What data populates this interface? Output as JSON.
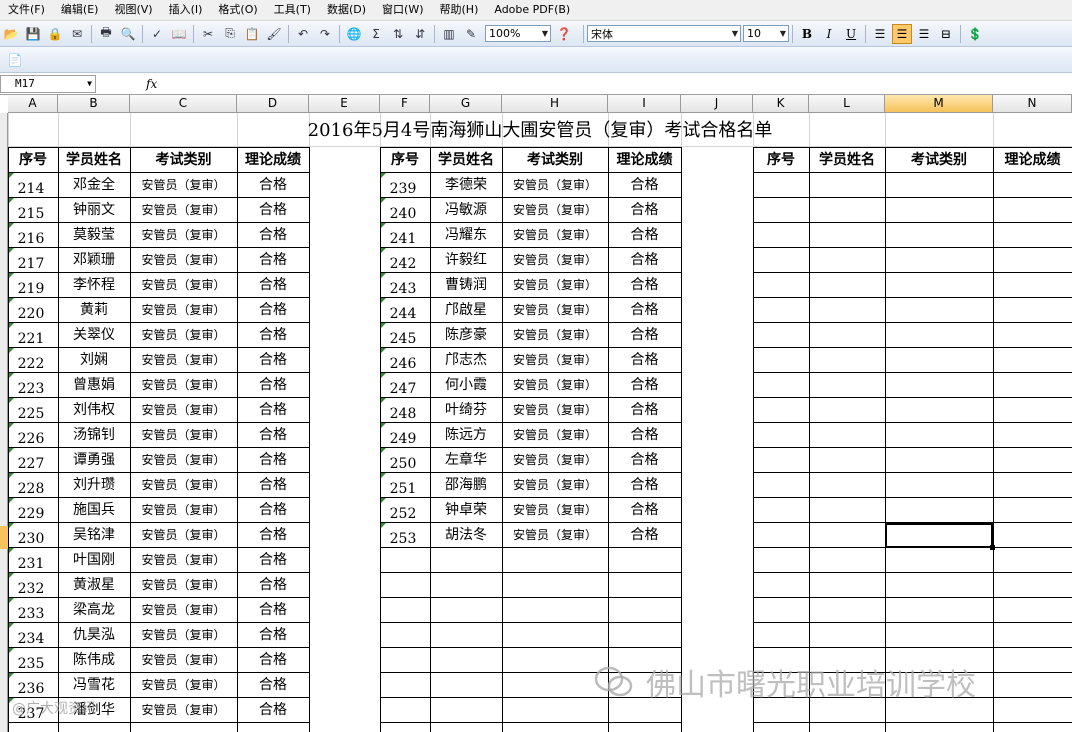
{
  "menu": [
    "文件(F)",
    "编辑(E)",
    "视图(V)",
    "插入(I)",
    "格式(O)",
    "工具(T)",
    "数据(D)",
    "窗口(W)",
    "帮助(H)",
    "Adobe PDF(B)"
  ],
  "toolbar": {
    "zoom": "100%",
    "font_name": "宋体",
    "font_size": "10",
    "bold": "B",
    "italic": "I",
    "underline": "U"
  },
  "formula_bar": {
    "cell_ref": "M17",
    "fx": "fx",
    "content": ""
  },
  "columns": [
    "A",
    "B",
    "C",
    "D",
    "E",
    "F",
    "G",
    "H",
    "I",
    "J",
    "K",
    "L",
    "M",
    "N"
  ],
  "selected_column": "M",
  "sheet": {
    "title": "2016年5月4号南海狮山大圃安管员（复审）考试合格名单",
    "headers": [
      "序号",
      "学员姓名",
      "考试类别",
      "理论成绩"
    ],
    "left": [
      [
        "214",
        "邓金全",
        "安管员（复审）",
        "合格"
      ],
      [
        "215",
        "钟丽文",
        "安管员（复审）",
        "合格"
      ],
      [
        "216",
        "莫毅莹",
        "安管员（复审）",
        "合格"
      ],
      [
        "217",
        "邓颖珊",
        "安管员（复审）",
        "合格"
      ],
      [
        "219",
        "李怀程",
        "安管员（复审）",
        "合格"
      ],
      [
        "220",
        "黄莉",
        "安管员（复审）",
        "合格"
      ],
      [
        "221",
        "关翠仪",
        "安管员（复审）",
        "合格"
      ],
      [
        "222",
        "刘娴",
        "安管员（复审）",
        "合格"
      ],
      [
        "223",
        "曾惠娟",
        "安管员（复审）",
        "合格"
      ],
      [
        "225",
        "刘伟权",
        "安管员（复审）",
        "合格"
      ],
      [
        "226",
        "汤锦钊",
        "安管员（复审）",
        "合格"
      ],
      [
        "227",
        "谭勇强",
        "安管员（复审）",
        "合格"
      ],
      [
        "228",
        "刘升瓒",
        "安管员（复审）",
        "合格"
      ],
      [
        "229",
        "施国兵",
        "安管员（复审）",
        "合格"
      ],
      [
        "230",
        "吴铭津",
        "安管员（复审）",
        "合格"
      ],
      [
        "231",
        "叶国刚",
        "安管员（复审）",
        "合格"
      ],
      [
        "232",
        "黄淑星",
        "安管员（复审）",
        "合格"
      ],
      [
        "233",
        "梁高龙",
        "安管员（复审）",
        "合格"
      ],
      [
        "234",
        "仇昊泓",
        "安管员（复审）",
        "合格"
      ],
      [
        "235",
        "陈伟成",
        "安管员（复审）",
        "合格"
      ],
      [
        "236",
        "冯雪花",
        "安管员（复审）",
        "合格"
      ],
      [
        "237",
        "潘剑华",
        "安管员（复审）",
        "合格"
      ]
    ],
    "middle": [
      [
        "239",
        "李德荣",
        "安管员（复审）",
        "合格"
      ],
      [
        "240",
        "冯敏源",
        "安管员（复审）",
        "合格"
      ],
      [
        "241",
        "冯耀东",
        "安管员（复审）",
        "合格"
      ],
      [
        "242",
        "许毅红",
        "安管员（复审）",
        "合格"
      ],
      [
        "243",
        "曹铸润",
        "安管员（复审）",
        "合格"
      ],
      [
        "244",
        "邝啟星",
        "安管员（复审）",
        "合格"
      ],
      [
        "245",
        "陈彦豪",
        "安管员（复审）",
        "合格"
      ],
      [
        "246",
        "邝志杰",
        "安管员（复审）",
        "合格"
      ],
      [
        "247",
        "何小霞",
        "安管员（复审）",
        "合格"
      ],
      [
        "248",
        "叶绮芬",
        "安管员（复审）",
        "合格"
      ],
      [
        "249",
        "陈远方",
        "安管员（复审）",
        "合格"
      ],
      [
        "250",
        "左章华",
        "安管员（复审）",
        "合格"
      ],
      [
        "251",
        "邵海鹏",
        "安管员（复审）",
        "合格"
      ],
      [
        "252",
        "钟卓荣",
        "安管员（复审）",
        "合格"
      ],
      [
        "253",
        "胡法冬",
        "安管员（复审）",
        "合格"
      ]
    ]
  },
  "watermark": "佛山市曙光职业培训学校",
  "watermark2": "@广大观资讯"
}
